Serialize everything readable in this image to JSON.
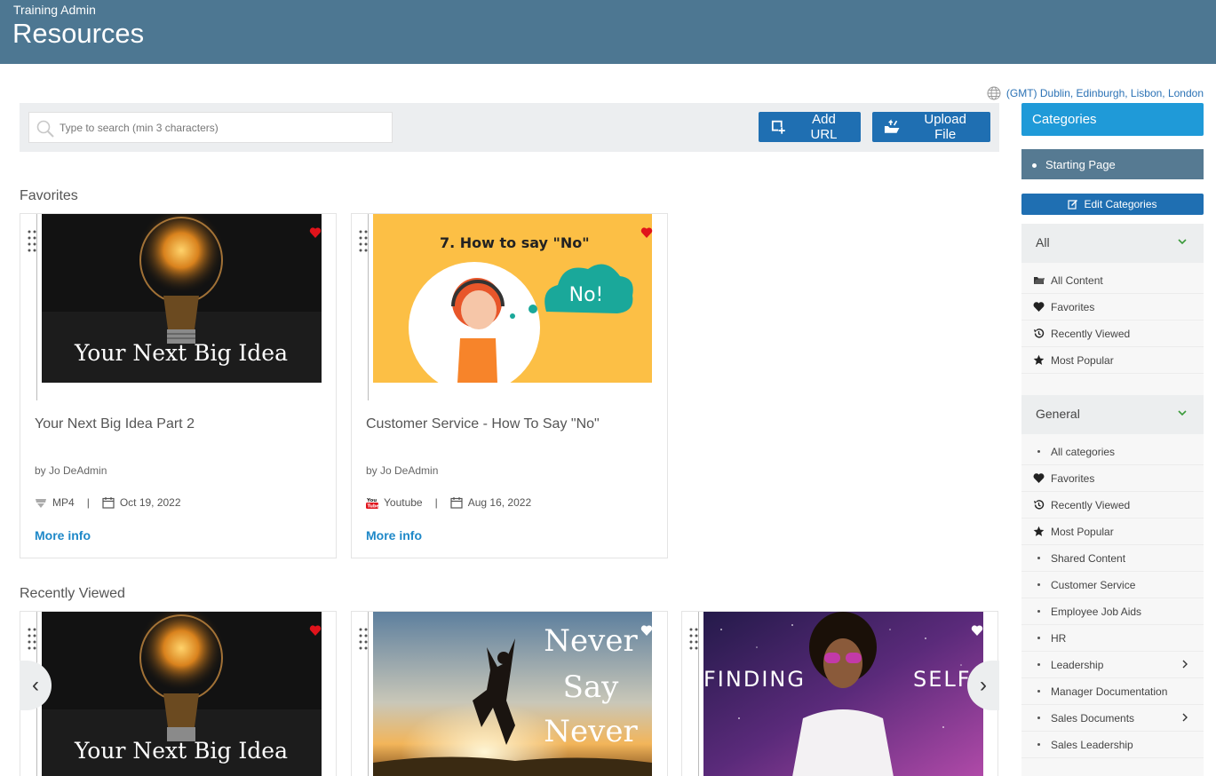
{
  "header": {
    "subtitle": "Training Admin",
    "title": "Resources"
  },
  "timezone": "(GMT) Dublin, Edinburgh, Lisbon, London",
  "toolbar": {
    "search_placeholder": "Type to search (min 3 characters)",
    "add_url_label": "Add URL",
    "upload_file_label": "Upload File"
  },
  "favorites": {
    "title": "Favorites",
    "cards": [
      {
        "thumb_text": "Your Next Big Idea",
        "title": "Your Next Big Idea Part 2",
        "author": "by Jo DeAdmin",
        "type": "MP4",
        "date": "Oct 19, 2022",
        "more": "More info",
        "favorite": true
      },
      {
        "thumb_text": "7. How to say \"No\"",
        "thumb_bubble": "No!",
        "title": "Customer Service - How To Say \"No\"",
        "author": "by Jo DeAdmin",
        "type": "Youtube",
        "date": "Aug 16, 2022",
        "more": "More info",
        "favorite": true
      }
    ]
  },
  "recent": {
    "title": "Recently Viewed",
    "cards": [
      {
        "thumb_text": "Your Next Big Idea",
        "favorite": true
      },
      {
        "thumb_text_lines": [
          "Never",
          "Say",
          "Never"
        ],
        "favorite": false
      },
      {
        "thumb_left": "FINDING",
        "thumb_right": "SELF",
        "favorite": false
      }
    ]
  },
  "sidebar": {
    "categories_label": "Categories",
    "starting_page": "Starting Page",
    "edit_categories": "Edit Categories",
    "all_group": {
      "label": "All",
      "items": [
        {
          "label": "All Content",
          "icon": "folder-icon"
        },
        {
          "label": "Favorites",
          "icon": "heart-icon"
        },
        {
          "label": "Recently Viewed",
          "icon": "history-icon"
        },
        {
          "label": "Most Popular",
          "icon": "star-icon"
        }
      ]
    },
    "general_group": {
      "label": "General",
      "items": [
        {
          "label": "All categories",
          "icon": "bullet"
        },
        {
          "label": "Favorites",
          "icon": "heart-icon"
        },
        {
          "label": "Recently Viewed",
          "icon": "history-icon"
        },
        {
          "label": "Most Popular",
          "icon": "star-icon"
        },
        {
          "label": "Shared Content",
          "icon": "bullet"
        },
        {
          "label": "Customer Service",
          "icon": "bullet"
        },
        {
          "label": "Employee Job Aids",
          "icon": "bullet"
        },
        {
          "label": "HR",
          "icon": "bullet"
        },
        {
          "label": "Leadership",
          "icon": "bullet",
          "has_children": true
        },
        {
          "label": "Manager Documentation",
          "icon": "bullet"
        },
        {
          "label": "Sales Documents",
          "icon": "bullet",
          "has_children": true
        },
        {
          "label": "Sales Leadership",
          "icon": "bullet"
        }
      ]
    }
  },
  "colors": {
    "header": "#4d7792",
    "primary_button": "#1f6fb2",
    "categories_header": "#1f9ad8",
    "link": "#1e88c8",
    "favorite_heart": "#e0131b"
  }
}
